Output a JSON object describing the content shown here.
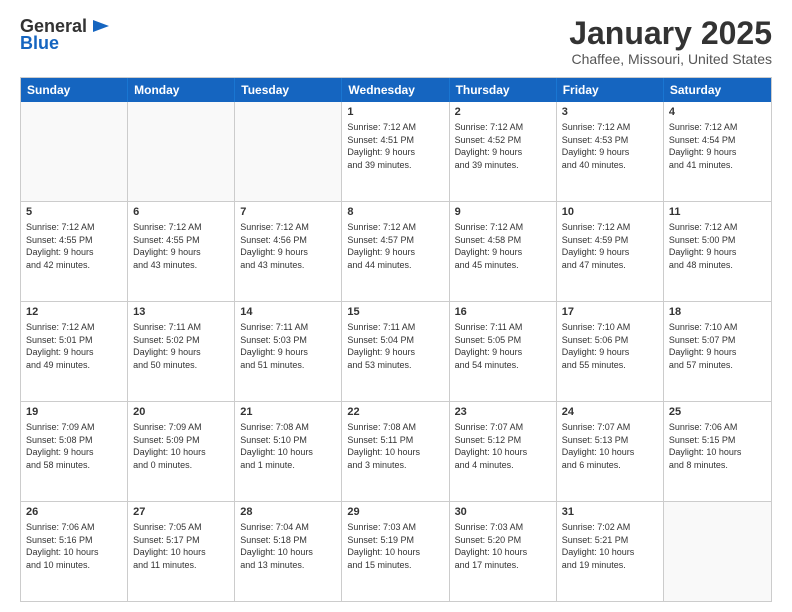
{
  "header": {
    "logo_general": "General",
    "logo_blue": "Blue",
    "month": "January 2025",
    "location": "Chaffee, Missouri, United States"
  },
  "weekdays": [
    "Sunday",
    "Monday",
    "Tuesday",
    "Wednesday",
    "Thursday",
    "Friday",
    "Saturday"
  ],
  "rows": [
    [
      {
        "day": "",
        "info": "",
        "empty": true
      },
      {
        "day": "",
        "info": "",
        "empty": true
      },
      {
        "day": "",
        "info": "",
        "empty": true
      },
      {
        "day": "1",
        "info": "Sunrise: 7:12 AM\nSunset: 4:51 PM\nDaylight: 9 hours\nand 39 minutes."
      },
      {
        "day": "2",
        "info": "Sunrise: 7:12 AM\nSunset: 4:52 PM\nDaylight: 9 hours\nand 39 minutes."
      },
      {
        "day": "3",
        "info": "Sunrise: 7:12 AM\nSunset: 4:53 PM\nDaylight: 9 hours\nand 40 minutes."
      },
      {
        "day": "4",
        "info": "Sunrise: 7:12 AM\nSunset: 4:54 PM\nDaylight: 9 hours\nand 41 minutes."
      }
    ],
    [
      {
        "day": "5",
        "info": "Sunrise: 7:12 AM\nSunset: 4:55 PM\nDaylight: 9 hours\nand 42 minutes."
      },
      {
        "day": "6",
        "info": "Sunrise: 7:12 AM\nSunset: 4:55 PM\nDaylight: 9 hours\nand 43 minutes."
      },
      {
        "day": "7",
        "info": "Sunrise: 7:12 AM\nSunset: 4:56 PM\nDaylight: 9 hours\nand 43 minutes."
      },
      {
        "day": "8",
        "info": "Sunrise: 7:12 AM\nSunset: 4:57 PM\nDaylight: 9 hours\nand 44 minutes."
      },
      {
        "day": "9",
        "info": "Sunrise: 7:12 AM\nSunset: 4:58 PM\nDaylight: 9 hours\nand 45 minutes."
      },
      {
        "day": "10",
        "info": "Sunrise: 7:12 AM\nSunset: 4:59 PM\nDaylight: 9 hours\nand 47 minutes."
      },
      {
        "day": "11",
        "info": "Sunrise: 7:12 AM\nSunset: 5:00 PM\nDaylight: 9 hours\nand 48 minutes."
      }
    ],
    [
      {
        "day": "12",
        "info": "Sunrise: 7:12 AM\nSunset: 5:01 PM\nDaylight: 9 hours\nand 49 minutes."
      },
      {
        "day": "13",
        "info": "Sunrise: 7:11 AM\nSunset: 5:02 PM\nDaylight: 9 hours\nand 50 minutes."
      },
      {
        "day": "14",
        "info": "Sunrise: 7:11 AM\nSunset: 5:03 PM\nDaylight: 9 hours\nand 51 minutes."
      },
      {
        "day": "15",
        "info": "Sunrise: 7:11 AM\nSunset: 5:04 PM\nDaylight: 9 hours\nand 53 minutes."
      },
      {
        "day": "16",
        "info": "Sunrise: 7:11 AM\nSunset: 5:05 PM\nDaylight: 9 hours\nand 54 minutes."
      },
      {
        "day": "17",
        "info": "Sunrise: 7:10 AM\nSunset: 5:06 PM\nDaylight: 9 hours\nand 55 minutes."
      },
      {
        "day": "18",
        "info": "Sunrise: 7:10 AM\nSunset: 5:07 PM\nDaylight: 9 hours\nand 57 minutes."
      }
    ],
    [
      {
        "day": "19",
        "info": "Sunrise: 7:09 AM\nSunset: 5:08 PM\nDaylight: 9 hours\nand 58 minutes."
      },
      {
        "day": "20",
        "info": "Sunrise: 7:09 AM\nSunset: 5:09 PM\nDaylight: 10 hours\nand 0 minutes."
      },
      {
        "day": "21",
        "info": "Sunrise: 7:08 AM\nSunset: 5:10 PM\nDaylight: 10 hours\nand 1 minute."
      },
      {
        "day": "22",
        "info": "Sunrise: 7:08 AM\nSunset: 5:11 PM\nDaylight: 10 hours\nand 3 minutes."
      },
      {
        "day": "23",
        "info": "Sunrise: 7:07 AM\nSunset: 5:12 PM\nDaylight: 10 hours\nand 4 minutes."
      },
      {
        "day": "24",
        "info": "Sunrise: 7:07 AM\nSunset: 5:13 PM\nDaylight: 10 hours\nand 6 minutes."
      },
      {
        "day": "25",
        "info": "Sunrise: 7:06 AM\nSunset: 5:15 PM\nDaylight: 10 hours\nand 8 minutes."
      }
    ],
    [
      {
        "day": "26",
        "info": "Sunrise: 7:06 AM\nSunset: 5:16 PM\nDaylight: 10 hours\nand 10 minutes."
      },
      {
        "day": "27",
        "info": "Sunrise: 7:05 AM\nSunset: 5:17 PM\nDaylight: 10 hours\nand 11 minutes."
      },
      {
        "day": "28",
        "info": "Sunrise: 7:04 AM\nSunset: 5:18 PM\nDaylight: 10 hours\nand 13 minutes."
      },
      {
        "day": "29",
        "info": "Sunrise: 7:03 AM\nSunset: 5:19 PM\nDaylight: 10 hours\nand 15 minutes."
      },
      {
        "day": "30",
        "info": "Sunrise: 7:03 AM\nSunset: 5:20 PM\nDaylight: 10 hours\nand 17 minutes."
      },
      {
        "day": "31",
        "info": "Sunrise: 7:02 AM\nSunset: 5:21 PM\nDaylight: 10 hours\nand 19 minutes."
      },
      {
        "day": "",
        "info": "",
        "empty": true
      }
    ]
  ]
}
